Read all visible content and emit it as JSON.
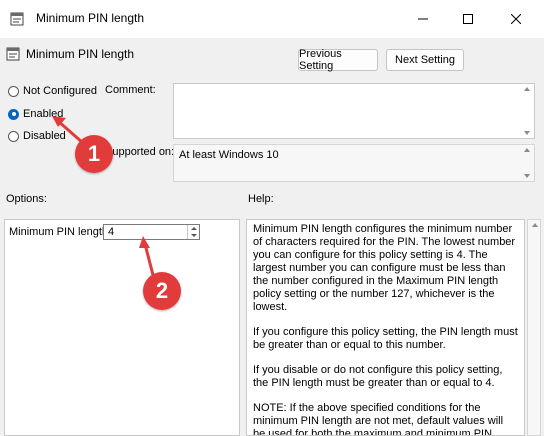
{
  "window": {
    "title": "Minimum PIN length",
    "controls": [
      "minimize-icon",
      "maximize-icon",
      "close-icon"
    ]
  },
  "header": {
    "policy_name": "Minimum PIN length",
    "previous_button": "Previous Setting",
    "next_button": "Next Setting"
  },
  "state": {
    "options": [
      {
        "label": "Not Configured",
        "checked": false
      },
      {
        "label": "Enabled",
        "checked": true
      },
      {
        "label": "Disabled",
        "checked": false
      }
    ]
  },
  "comment": {
    "label": "Comment:",
    "value": ""
  },
  "supported": {
    "label": "Supported on:",
    "value": "At least Windows 10"
  },
  "options_section": {
    "label": "Options:",
    "pin_label": "Minimum PIN length",
    "pin_value": "4"
  },
  "help": {
    "label": "Help:",
    "paragraphs": [
      "Minimum PIN length configures the minimum number of characters required for the PIN.  The lowest number you can configure for this policy setting is 4.  The largest number you can configure must be less than the number configured in the Maximum PIN length policy setting or the number 127, whichever is the lowest.",
      "If you configure this policy setting, the PIN length must be greater than or equal to this number.",
      "If you disable or do not configure this policy setting, the PIN length must be greater than or equal to 4.",
      "NOTE: If the above specified conditions for the minimum PIN length are not met, default values will be used for both the maximum and minimum PIN lengths."
    ]
  },
  "annotations": {
    "marker1": "1",
    "marker2": "2"
  },
  "colors": {
    "accent": "#0067c0",
    "marker": "#e23b3b"
  }
}
